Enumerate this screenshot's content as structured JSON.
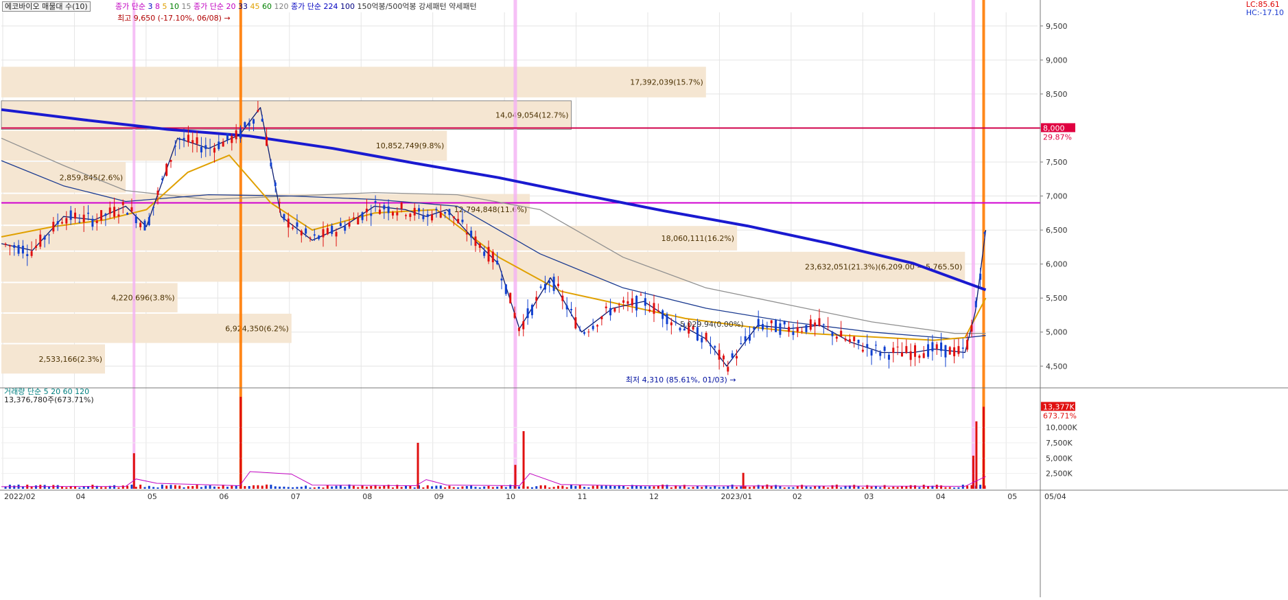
{
  "chart_data": {
    "type": "line",
    "title": "에코바이오 매물대 수(10)",
    "legend": [
      {
        "label": "종가 단순",
        "color": "#c000c0"
      },
      {
        "label": "3",
        "color": "#0000c0"
      },
      {
        "label": "8",
        "color": "#c000c0"
      },
      {
        "label": "5",
        "color": "#e0a000"
      },
      {
        "label": "10",
        "color": "#008000"
      },
      {
        "label": "15",
        "color": "#808080"
      },
      {
        "label": "종가 단순",
        "color": "#c000c0"
      },
      {
        "label": "20",
        "color": "#c000c0"
      },
      {
        "label": "33",
        "color": "#000080"
      },
      {
        "label": "45",
        "color": "#e0a000"
      },
      {
        "label": "60",
        "color": "#008000"
      },
      {
        "label": "120",
        "color": "#808080"
      },
      {
        "label": "종가 단순",
        "color": "#0000c0"
      },
      {
        "label": "224",
        "color": "#0000c0"
      },
      {
        "label": "100",
        "color": "#000080"
      },
      {
        "label": "150억봉/500억봉",
        "color": "#333333"
      },
      {
        "label": "강세패턴",
        "color": "#333333"
      },
      {
        "label": "약세패턴",
        "color": "#333333"
      }
    ],
    "ylim": [
      4200,
      9700
    ],
    "y_ticks": [
      "9,500",
      "9,000",
      "8,500",
      "8,000",
      "7,500",
      "7,000",
      "6,500",
      "6,000",
      "5,500",
      "5,000",
      "4,500"
    ],
    "x_ticks": [
      "2022/02",
      "04",
      "05",
      "06",
      "07",
      "08",
      "09",
      "10",
      "11",
      "12",
      "2023/01",
      "02",
      "03",
      "04",
      "05",
      "05/04"
    ],
    "max_annotation": "최고 9,650 (-17.10%, 06/08)",
    "min_annotation": "최저 4,310 (85.61%, 01/03)",
    "top_right_labels": [
      "LC:85.61",
      "HC:-17.10"
    ],
    "price_badges": [
      {
        "label": "8,000",
        "sub": "29.87%",
        "color": "#e00040"
      }
    ],
    "horizontal_lines": [
      {
        "value": 8000,
        "color": "#d0004a"
      },
      {
        "value": 6900,
        "color": "#d000d0"
      }
    ],
    "volume_profile": [
      {
        "low": 8450,
        "high": 8900,
        "label": "17,392,039(15.7%)"
      },
      {
        "low": 7980,
        "high": 8400,
        "label": "14,049,054(12.7%)"
      },
      {
        "low": 7520,
        "high": 7960,
        "label": "10,852,749(9.8%)"
      },
      {
        "low": 7050,
        "high": 7500,
        "label": "2,859,845(2.6%)"
      },
      {
        "low": 6580,
        "high": 7030,
        "label": "12,794,848(11.6%)"
      },
      {
        "low": 6200,
        "high": 6560,
        "label": "18,060,111(16.2%)"
      },
      {
        "low": 5740,
        "high": 6180,
        "label": "23,632,051(21.3%)(6,209.00 ~ 5,765.50)"
      },
      {
        "low": 5290,
        "high": 5720,
        "label": "4,220,696(3.8%)"
      },
      {
        "low": 4840,
        "high": 5270,
        "label": "6,924,350(6.2%)"
      },
      {
        "low": 4390,
        "high": 4820,
        "label": "2,533,166(2.3%)"
      }
    ],
    "mid_label": "5,029.94(0.00%)",
    "series": [
      {
        "name": "224",
        "color": "#1a1ad0",
        "x": [
          0,
          0.08,
          0.16,
          0.24,
          0.32,
          0.4,
          0.48,
          0.56,
          0.64,
          0.72,
          0.8,
          0.88,
          0.95
        ],
        "values": [
          8270,
          8120,
          7980,
          7880,
          7700,
          7480,
          7270,
          7020,
          6780,
          6560,
          6300,
          6010,
          5620
        ]
      },
      {
        "name": "120",
        "color": "#909090",
        "x": [
          0,
          0.06,
          0.12,
          0.2,
          0.28,
          0.36,
          0.44,
          0.52,
          0.6,
          0.68,
          0.76,
          0.84,
          0.92,
          0.95
        ],
        "values": [
          7850,
          7450,
          7080,
          6950,
          7000,
          7050,
          7020,
          6800,
          6100,
          5650,
          5400,
          5150,
          4980,
          4980
        ]
      },
      {
        "name": "60",
        "color": "#1a3a90",
        "x": [
          0,
          0.06,
          0.12,
          0.2,
          0.28,
          0.36,
          0.44,
          0.52,
          0.6,
          0.68,
          0.76,
          0.84,
          0.92,
          0.95
        ],
        "values": [
          7520,
          7150,
          6920,
          7020,
          7000,
          6950,
          6850,
          6150,
          5650,
          5350,
          5150,
          5000,
          4900,
          4950
        ]
      },
      {
        "name": "20",
        "color": "#e0a000",
        "x": [
          0,
          0.05,
          0.1,
          0.14,
          0.18,
          0.22,
          0.26,
          0.3,
          0.36,
          0.42,
          0.48,
          0.54,
          0.6,
          0.66,
          0.72,
          0.78,
          0.84,
          0.9,
          0.93,
          0.95
        ],
        "values": [
          6400,
          6550,
          6650,
          6800,
          7350,
          7600,
          6900,
          6500,
          6750,
          6800,
          6100,
          5600,
          5400,
          5200,
          5080,
          4980,
          4930,
          4880,
          4920,
          5500
        ]
      },
      {
        "name": "5",
        "color": "#0a1a70",
        "x": [
          0,
          0.03,
          0.06,
          0.09,
          0.12,
          0.14,
          0.17,
          0.2,
          0.23,
          0.25,
          0.27,
          0.3,
          0.33,
          0.36,
          0.39,
          0.41,
          0.43,
          0.46,
          0.48,
          0.5,
          0.53,
          0.56,
          0.59,
          0.62,
          0.65,
          0.68,
          0.7,
          0.73,
          0.76,
          0.79,
          0.82,
          0.85,
          0.88,
          0.9,
          0.93,
          0.94,
          0.95
        ],
        "values": [
          6300,
          6200,
          6700,
          6650,
          6850,
          6550,
          7850,
          7700,
          7900,
          8300,
          6700,
          6350,
          6550,
          6850,
          6800,
          6700,
          6800,
          6300,
          6000,
          5050,
          5800,
          5000,
          5350,
          5450,
          5150,
          4900,
          4500,
          5100,
          5050,
          5100,
          4850,
          4700,
          4700,
          4750,
          4700,
          5300,
          6500
        ]
      }
    ],
    "volume": {
      "title": "거래량 단순 5 20 60 120",
      "legend_colors": [
        "#00a0a0",
        "#c000c0",
        "#e0a000",
        "#008000",
        "#808080"
      ],
      "current_label": "13,376,780주(673.71%)",
      "badge": "13,377K",
      "badge_sub": "673.71%",
      "y_ticks": [
        "10,000K",
        "7,500K",
        "5,000K",
        "2,500K"
      ],
      "ylim": [
        0,
        15000
      ],
      "spikes": [
        {
          "x": 0.128,
          "value": 5800,
          "color": "#e01010"
        },
        {
          "x": 0.231,
          "value": 15000,
          "color": "#e01010"
        },
        {
          "x": 0.402,
          "value": 7500,
          "color": "#e01010"
        },
        {
          "x": 0.496,
          "value": 3900,
          "color": "#e01010"
        },
        {
          "x": 0.504,
          "value": 9400,
          "color": "#e01010"
        },
        {
          "x": 0.716,
          "value": 2600,
          "color": "#e01010"
        },
        {
          "x": 0.938,
          "value": 5400,
          "color": "#e01010"
        },
        {
          "x": 0.941,
          "value": 11000,
          "color": "#e01010"
        },
        {
          "x": 0.948,
          "value": 13377,
          "color": "#e01010"
        }
      ]
    }
  }
}
